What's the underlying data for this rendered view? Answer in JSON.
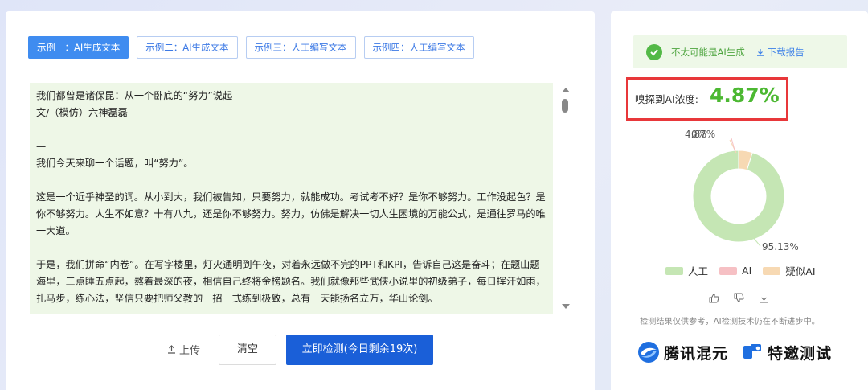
{
  "tabs": [
    {
      "label": "示例一：AI生成文本",
      "active": true
    },
    {
      "label": "示例二：AI生成文本",
      "active": false
    },
    {
      "label": "示例三：人工编写文本",
      "active": false
    },
    {
      "label": "示例四：人工编写文本",
      "active": false
    }
  ],
  "text_box": {
    "paragraphs": [
      "我们都曾是诸保昆：从一个卧底的“努力”说起",
      "文/（模仿）六神磊磊",
      "",
      "—",
      "我们今天来聊一个话题，叫“努力”。",
      "",
      "这是一个近乎神圣的词。从小到大，我们被告知，只要努力，就能成功。考试考不好？是你不够努力。工作没起色？是你不够努力。人生不如意？十有八九，还是你不够努力。努力，仿佛是解决一切人生困境的万能公式，是通往罗马的唯一大道。",
      "",
      "于是，我们拼命“内卷”。在写字楼里，灯火通明到午夜，对着永远做不完的PPT和KPI，告诉自己这是奋斗；在题山题海里，三点睡五点起，熬着最深的夜，相信自己终将金榜题名。我们就像那些武侠小说里的初级弟子，每日挥汗如雨，扎马步，练心法，坚信只要把师父教的一招一式练到极致，总有一天能扬名立万，华山论剑。"
    ]
  },
  "actions": {
    "upload": "上传",
    "clear": "清空",
    "detect": "立即检测(今日剩余19次)"
  },
  "result": {
    "status": "不太可能是AI生成",
    "download": "下载报告",
    "score_label": "嗅探到AI浓度:",
    "score_value": "4.87%"
  },
  "chart_data": {
    "type": "pie",
    "series": [
      {
        "name": "人工",
        "value": 95.13,
        "color": "#c5e6b4"
      },
      {
        "name": "AI",
        "value": 0.0,
        "color": "#f6c0c4"
      },
      {
        "name": "疑似AI",
        "value": 4.87,
        "color": "#f7d9b3"
      }
    ],
    "labels": [
      "4.87%",
      "0%",
      "95.13%"
    ]
  },
  "legend": [
    {
      "label": "人工",
      "color": "#c5e6b4"
    },
    {
      "label": "AI",
      "color": "#f6c0c4"
    },
    {
      "label": "疑似AI",
      "color": "#f7d9b3"
    }
  ],
  "disclaimer": "检测结果仅供参考，AI检测技术仍在不断进步中。",
  "logos": {
    "left": "腾讯混元",
    "right": "特邀测试"
  }
}
